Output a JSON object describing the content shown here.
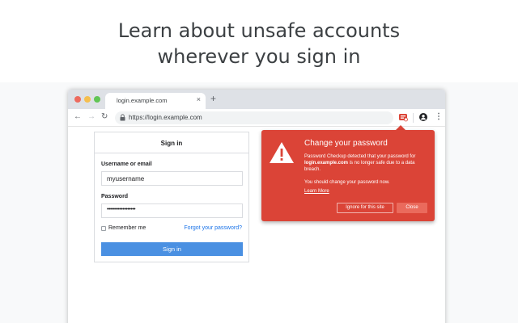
{
  "headline": {
    "line1": "Learn about unsafe accounts",
    "line2": "wherever you sign in"
  },
  "browser": {
    "tab": {
      "title": "login.example.com",
      "close": "×"
    },
    "new_tab": "+",
    "nav": {
      "back": "←",
      "forward": "→",
      "reload": "↻"
    },
    "url": "https://login.example.com",
    "menu": "⋮",
    "icons": {
      "lock": "lock-icon",
      "extension": "password-checkup-extension-icon",
      "account": "account-icon"
    }
  },
  "signin": {
    "title": "Sign in",
    "username_label": "Username or email",
    "username_value": "myusername",
    "password_label": "Password",
    "password_value": "••••••••••••••••••",
    "remember_label": "Remember me",
    "forgot_link": "Forgot your password?",
    "submit_label": "Sign in"
  },
  "popup": {
    "title": "Change your password",
    "body_prefix": "Password Checkup detected that your password for ",
    "body_site": "login.example.com",
    "body_suffix": " is no longer safe due to a data breach.",
    "sub": "You should change your password now.",
    "learn_more": "Learn More",
    "ignore_label": "Ignore for this site",
    "close_label": "Close",
    "color": "#db4437"
  }
}
